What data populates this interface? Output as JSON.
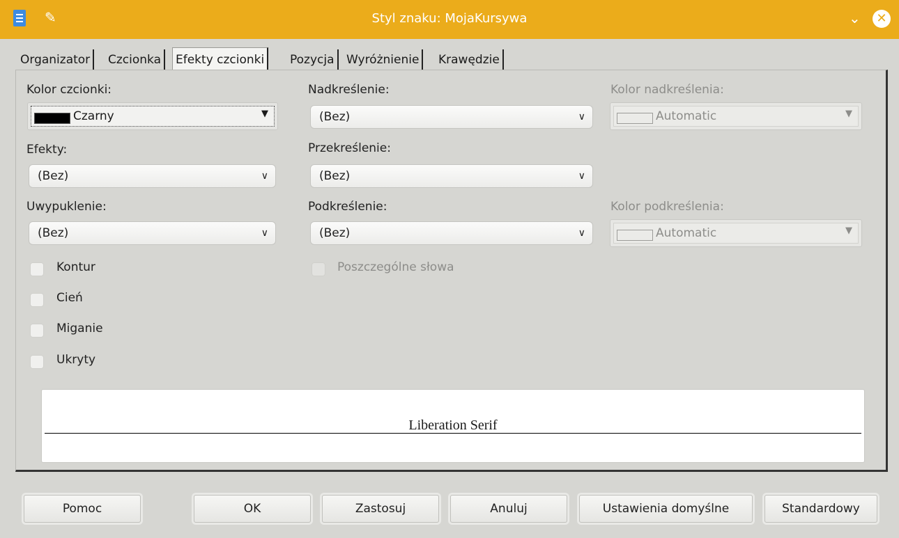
{
  "window": {
    "title": "Styl znaku: MojaKursywa"
  },
  "tabs": [
    {
      "label": "Organizator",
      "active": false
    },
    {
      "label": "Czcionka",
      "active": false
    },
    {
      "label": "Efekty czcionki",
      "active": true
    },
    {
      "label": "Pozycja",
      "active": false
    },
    {
      "label": "Wyróżnienie",
      "active": false
    },
    {
      "label": "Krawędzie",
      "active": false
    }
  ],
  "font_color": {
    "label": "Kolor czcionki:",
    "value": "Czarny",
    "swatch": "#000000"
  },
  "effects": {
    "label": "Efekty:",
    "value": "(Bez)"
  },
  "relief": {
    "label": "Uwypuklenie:",
    "value": "(Bez)"
  },
  "overline": {
    "label": "Nadkreślenie:",
    "value": "(Bez)",
    "color_label": "Kolor nadkreślenia:",
    "color_value": "Automatic"
  },
  "strikethrough": {
    "label": "Przekreślenie:",
    "value": "(Bez)"
  },
  "underline": {
    "label": "Podkreślenie:",
    "value": "(Bez)",
    "color_label": "Kolor podkreślenia:",
    "color_value": "Automatic"
  },
  "checkboxes": {
    "outline": "Kontur",
    "shadow": "Cień",
    "blinking": "Miganie",
    "hidden": "Ukryty",
    "individual_words": "Poszczególne słowa"
  },
  "preview": {
    "text": "Liberation Serif"
  },
  "buttons": {
    "help": "Pomoc",
    "ok": "OK",
    "apply": "Zastosuj",
    "cancel": "Anuluj",
    "set_default": "Ustawienia domyślne",
    "standard": "Standardowy"
  },
  "colors": {
    "titlebar": "#ebac1b",
    "background": "#d6d6d2"
  }
}
